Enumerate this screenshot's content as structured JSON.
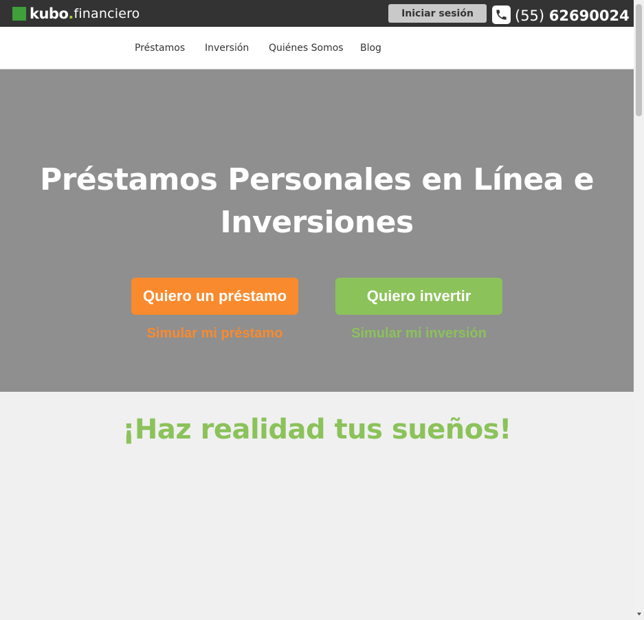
{
  "header": {
    "logo": {
      "brand": "kubo",
      "dot": ".",
      "suffix": "financiero"
    },
    "login_label": "Iniciar sesión",
    "phone_icon": "phone-icon",
    "phone_area": "(55)",
    "phone_number": "62690024"
  },
  "nav": {
    "items": [
      {
        "label": "Préstamos"
      },
      {
        "label": "Inversión"
      },
      {
        "label": "Quiénes Somos"
      },
      {
        "label": "Blog"
      }
    ]
  },
  "hero": {
    "title_line1": "Préstamos Personales en Línea e",
    "title_line2": "Inversiones",
    "loan_button": "Quiero un préstamo",
    "invest_button": "Quiero invertir",
    "simulate_loan": "Simular mi préstamo",
    "simulate_invest": "Simular mi inversión"
  },
  "section": {
    "tagline": "¡Haz realidad tus sueños!"
  },
  "colors": {
    "topbar": "#333333",
    "hero_bg": "#8f8f8f",
    "loan_orange": "#f98a2d",
    "invest_green": "#8bc25a",
    "logo_green": "#3f9f3a"
  }
}
